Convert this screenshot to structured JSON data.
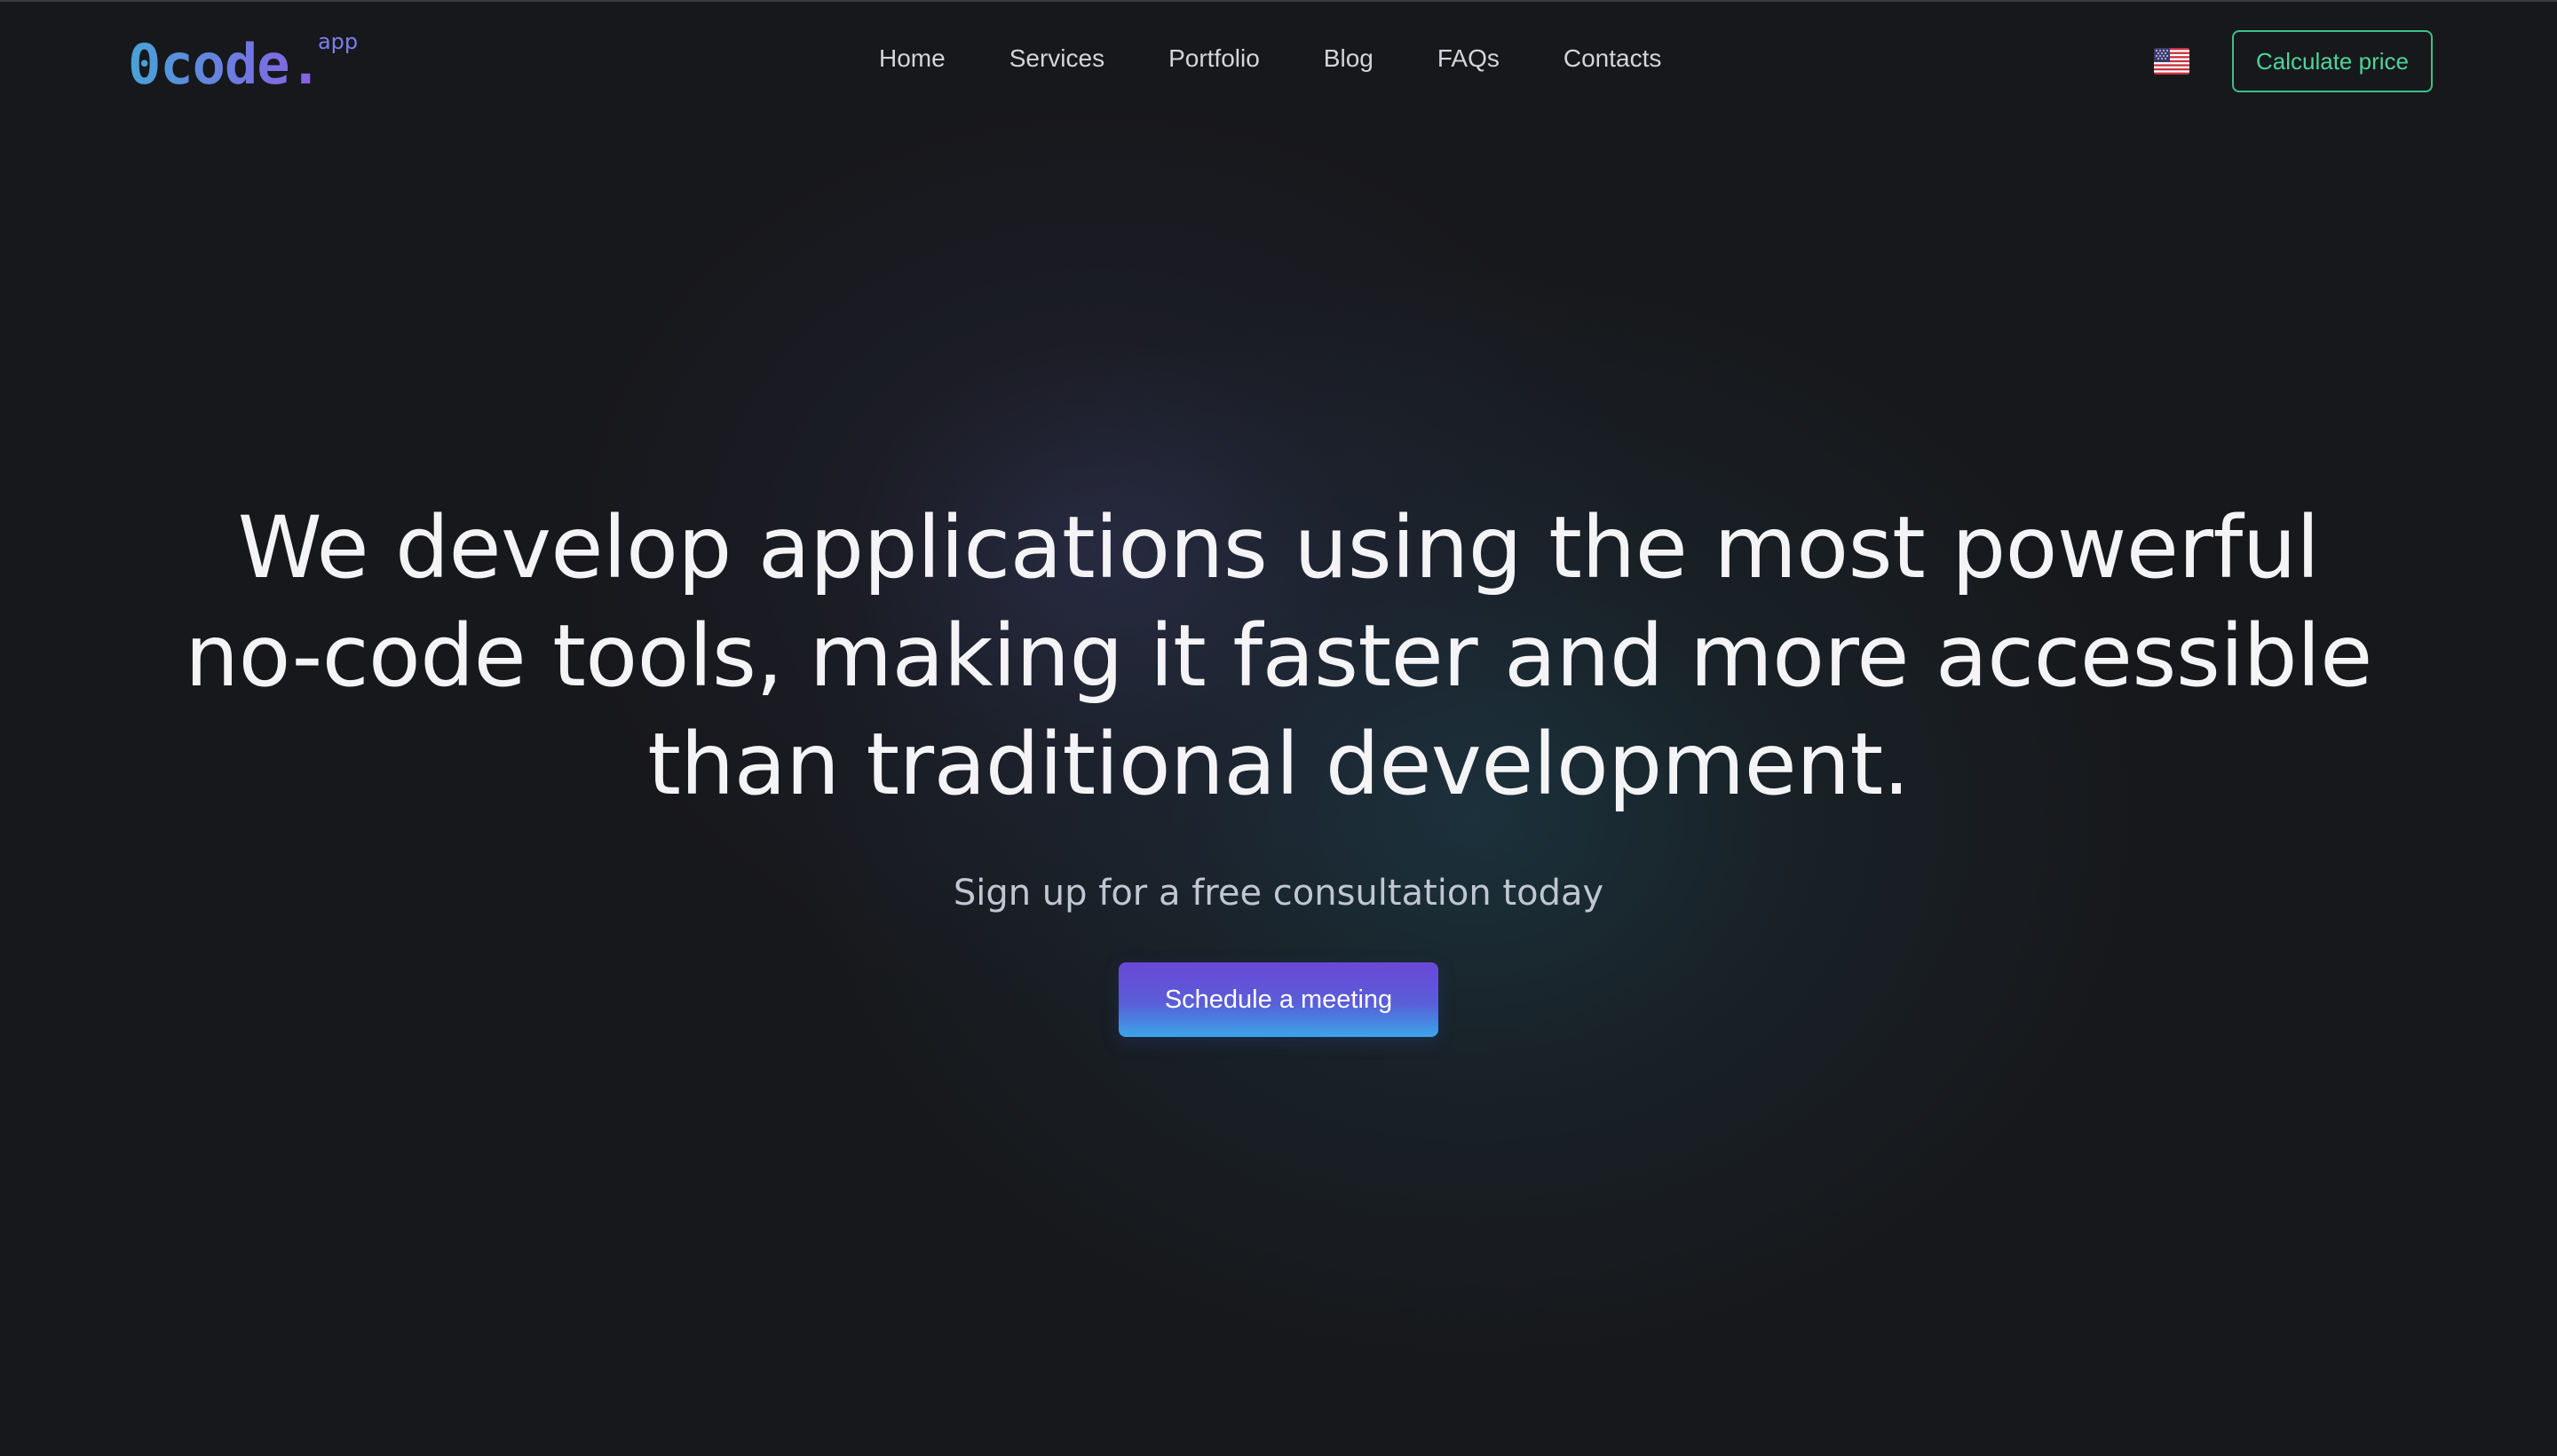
{
  "header": {
    "logo": {
      "main": "0code.",
      "sup": "app"
    },
    "nav": [
      "Home",
      "Services",
      "Portfolio",
      "Blog",
      "FAQs",
      "Contacts"
    ],
    "language_flag": "us-flag-icon",
    "cta_label": "Calculate price"
  },
  "hero": {
    "title": "We develop applications using the most powerful no-code tools, making it faster and more accessible than traditional development.",
    "subtitle": "Sign up for a free consultation today",
    "cta_label": "Schedule a meeting"
  },
  "colors": {
    "background": "#17181b",
    "accent_green": "#4fd39a",
    "cta_gradient_top": "#6a48d6",
    "cta_gradient_bottom": "#3aa6e8",
    "logo_gradient_start": "#46a4d8",
    "logo_gradient_end": "#8a5fe2"
  }
}
